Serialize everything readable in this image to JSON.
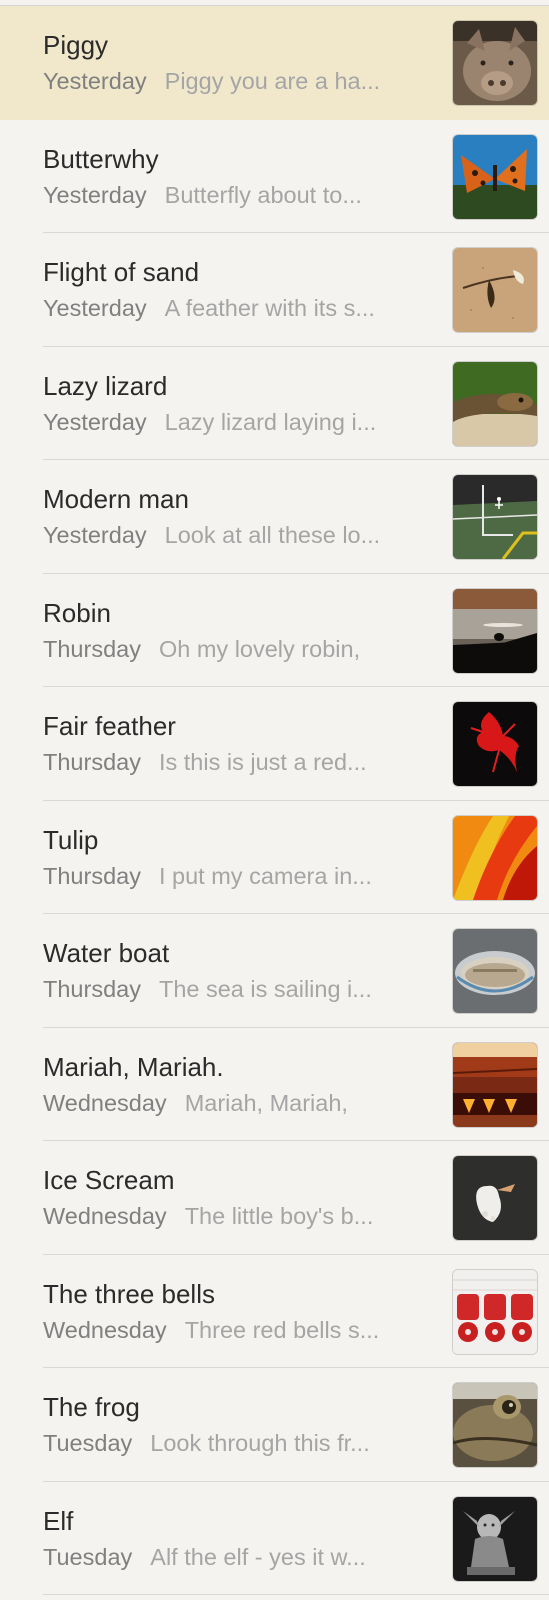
{
  "notes": [
    {
      "title": "Piggy",
      "date": "Yesterday",
      "preview": "Piggy you are a ha...",
      "selected": true,
      "thumbnail": "pig-photo"
    },
    {
      "title": "Butterwhy",
      "date": "Yesterday",
      "preview": "Butterfly about to...",
      "selected": false,
      "thumbnail": "butterfly-photo"
    },
    {
      "title": "Flight of sand",
      "date": "Yesterday",
      "preview": "A feather with its s...",
      "selected": false,
      "thumbnail": "feather-on-sand-photo"
    },
    {
      "title": "Lazy lizard",
      "date": "Yesterday",
      "preview": "Lazy lizard laying i...",
      "selected": false,
      "thumbnail": "lizard-photo"
    },
    {
      "title": "Modern man",
      "date": "Yesterday",
      "preview": "Look at all these lo...",
      "selected": false,
      "thumbnail": "sports-court-photo"
    },
    {
      "title": "Robin",
      "date": "Thursday",
      "preview": "Oh my lovely robin,",
      "selected": false,
      "thumbnail": "robin-silhouette-photo"
    },
    {
      "title": "Fair feather",
      "date": "Thursday",
      "preview": "Is this is just a red...",
      "selected": false,
      "thumbnail": "red-feather-photo"
    },
    {
      "title": "Tulip",
      "date": "Thursday",
      "preview": "I put my camera in...",
      "selected": false,
      "thumbnail": "tulip-closeup-photo"
    },
    {
      "title": "Water boat",
      "date": "Thursday",
      "preview": "The sea is sailing i...",
      "selected": false,
      "thumbnail": "rowing-boat-photo"
    },
    {
      "title": "Mariah, Mariah.",
      "date": "Wednesday",
      "preview": "Mariah, Mariah,",
      "selected": false,
      "thumbnail": "glowing-brazier-photo"
    },
    {
      "title": "Ice Scream",
      "date": "Wednesday",
      "preview": "The little boy's b...",
      "selected": false,
      "thumbnail": "ice-cream-photo"
    },
    {
      "title": "The three bells",
      "date": "Wednesday",
      "preview": "Three red bells s...",
      "selected": false,
      "thumbnail": "red-bells-photo"
    },
    {
      "title": "The frog",
      "date": "Tuesday",
      "preview": "Look through this fr...",
      "selected": false,
      "thumbnail": "frog-photo"
    },
    {
      "title": "Elf",
      "date": "Tuesday",
      "preview": "Alf the elf - yes it w...",
      "selected": false,
      "thumbnail": "elf-statue-photo"
    }
  ]
}
